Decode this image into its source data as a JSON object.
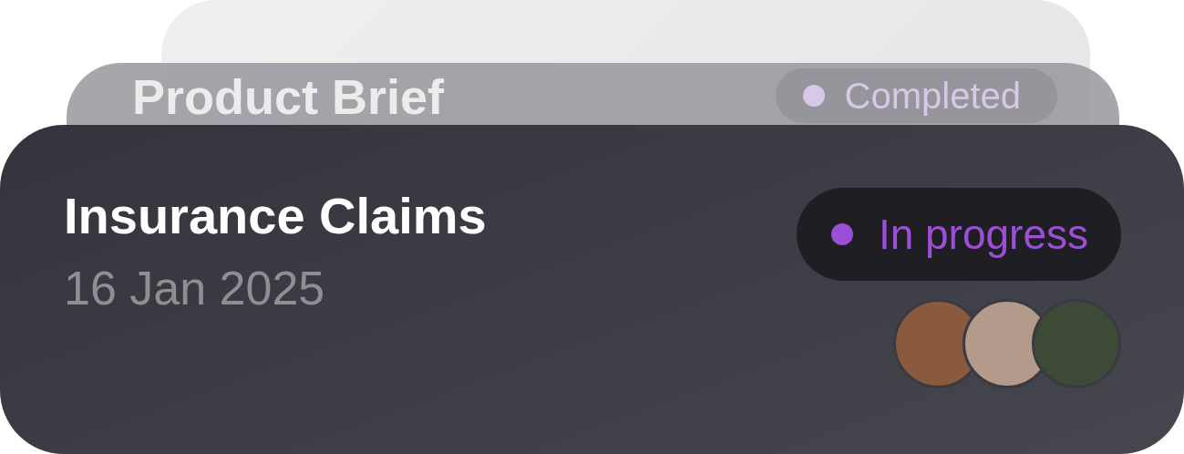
{
  "cards": [
    {
      "title": "Product Brief",
      "status": {
        "label": "Completed",
        "color": "#d6c8e6"
      }
    },
    {
      "title": "Insurance Claims",
      "date": "16 Jan 2025",
      "status": {
        "label": "In progress",
        "color": "#9b4fd6"
      }
    }
  ]
}
